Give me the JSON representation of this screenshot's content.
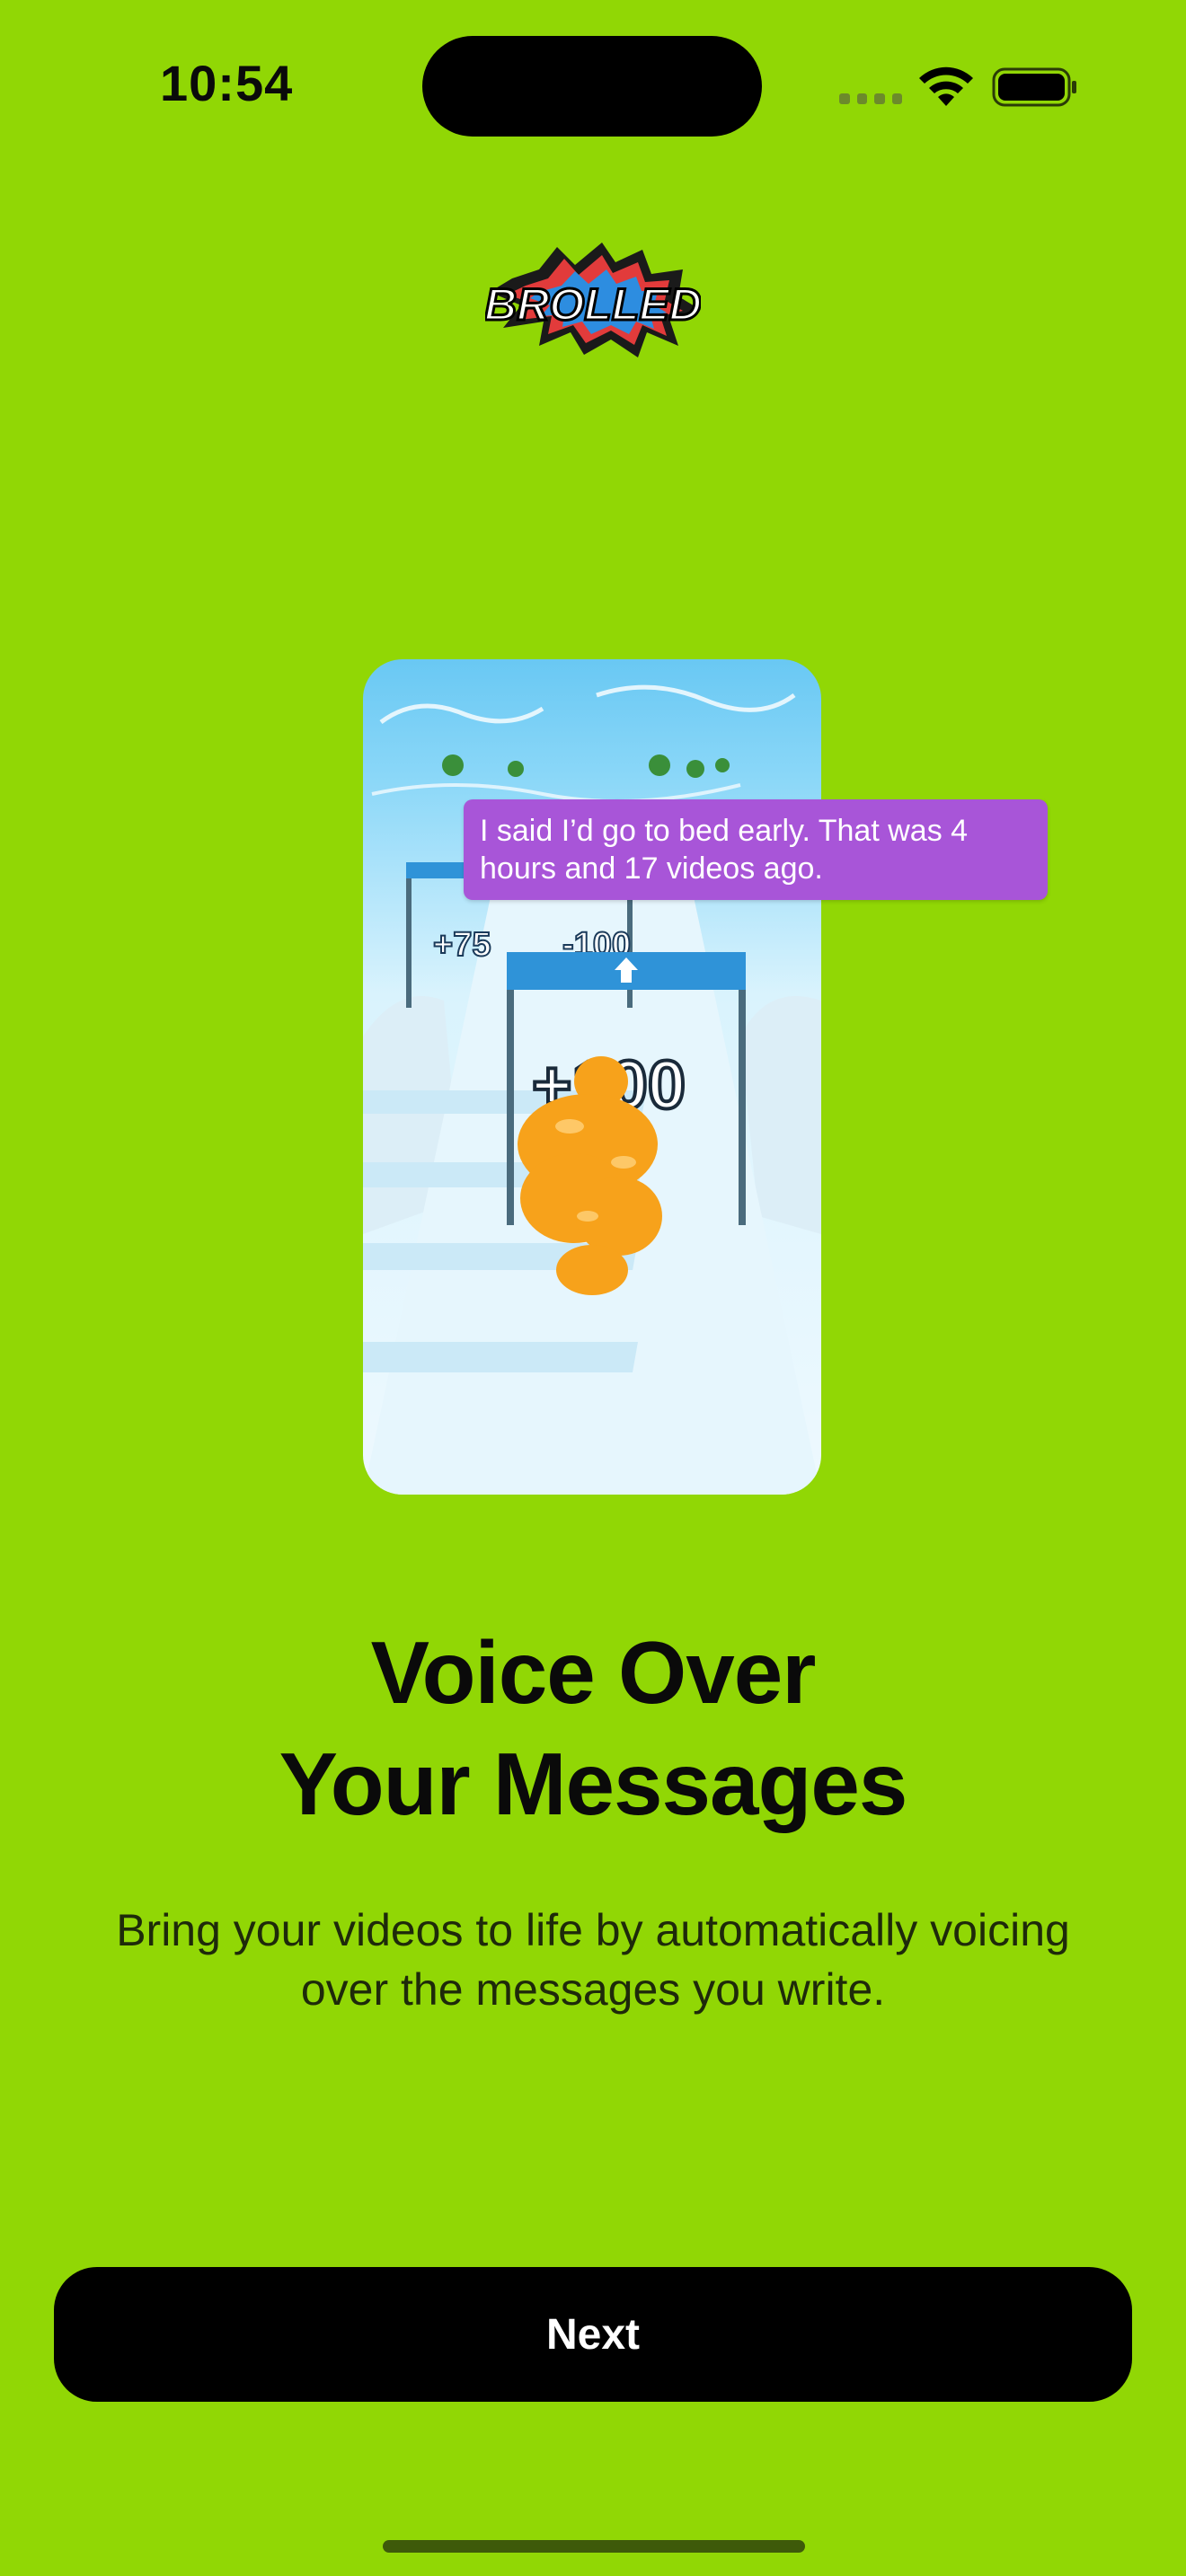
{
  "status_bar": {
    "time": "10:54",
    "icons": [
      "cellular-signal-icon",
      "wifi-icon",
      "battery-icon"
    ]
  },
  "header": {
    "logo_text": "BROLLED"
  },
  "preview": {
    "message": "I said I’d go to bed early. That was 4 hours and 17 videos ago.",
    "game_gate_labels": [
      "+75",
      "-100",
      "+100"
    ]
  },
  "content": {
    "title_line1": "Voice Over",
    "title_line2": "Your Messages",
    "subtitle": "Bring your videos to life by automatically voicing over the messages you write."
  },
  "actions": {
    "next_label": "Next"
  },
  "colors": {
    "background": "#91d705",
    "button": "#000000",
    "bubble": "#a855d8"
  }
}
